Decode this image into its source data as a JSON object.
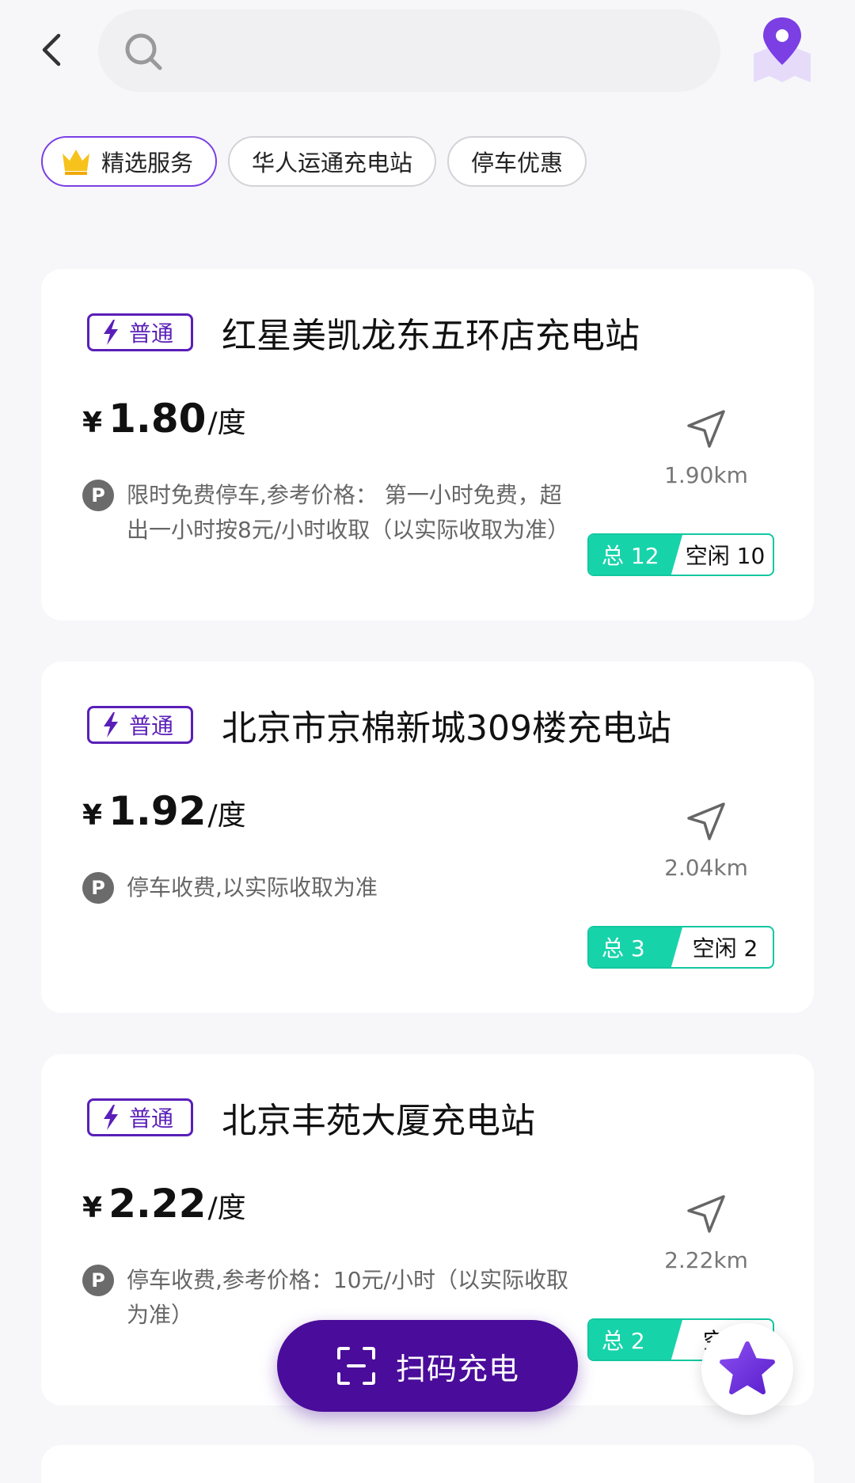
{
  "search": {
    "placeholder": ""
  },
  "filters": {
    "chips": [
      {
        "label": "精选服务",
        "selected": true,
        "icon": "crown-icon"
      },
      {
        "label": "华人运通充电站",
        "selected": false
      },
      {
        "label": "停车优惠",
        "selected": false
      }
    ]
  },
  "stations": [
    {
      "badge": "普通",
      "name": "红星美凯龙东五环店充电站",
      "price_symbol": "¥",
      "price": "1.80",
      "price_unit": "/度",
      "parking": "限时免费停车,参考价格：  第一小时免费，超出一小时按8元/小时收取（以实际收取为准）",
      "distance": "1.90km",
      "total": "总 12",
      "free": "空闲 10"
    },
    {
      "badge": "普通",
      "name": "北京市京棉新城309楼充电站",
      "price_symbol": "¥",
      "price": "1.92",
      "price_unit": "/度",
      "parking": "停车收费,以实际收取为准",
      "distance": "2.04km",
      "total": "总 3",
      "free": "空闲 2"
    },
    {
      "badge": "普通",
      "name": "北京丰苑大厦充电站",
      "price_symbol": "¥",
      "price": "2.22",
      "price_unit": "/度",
      "parking": "停车收费,参考价格：10元/小时（以实际收取为准）",
      "distance": "2.22km",
      "total": "总 2",
      "free": "空闲"
    }
  ],
  "actions": {
    "scan_label": "扫码充电"
  },
  "colors": {
    "brand_purple": "#4a0c9a",
    "accent_purple": "#7b3fe4",
    "availability_green": "#17d3aa"
  }
}
